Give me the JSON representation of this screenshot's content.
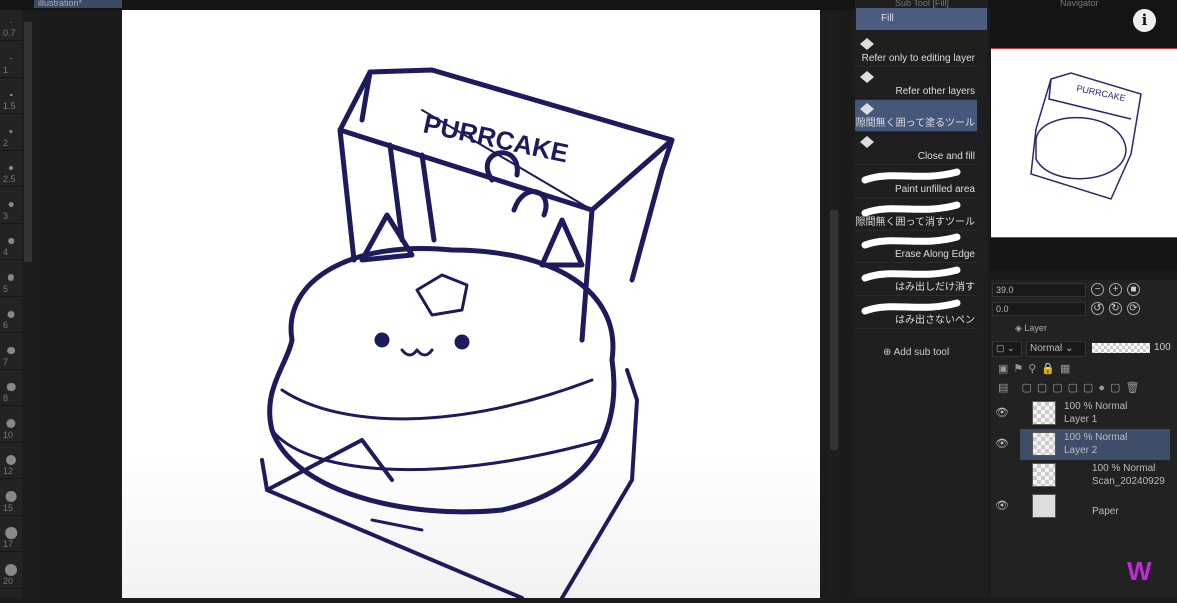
{
  "document_tab": "illustration*",
  "brush_sizes": [
    "0.7",
    "1",
    "1.5",
    "2",
    "2.5",
    "3",
    "4",
    "5",
    "6",
    "7",
    "8",
    "10",
    "12",
    "15",
    "17",
    "20"
  ],
  "subtool_panel": {
    "title": "Sub Tool [Fill]",
    "group": "Fill",
    "items": [
      {
        "label": "Refer only to editing layer",
        "selected": false
      },
      {
        "label": "Refer other layers",
        "selected": false
      },
      {
        "label": "隙間無く囲って塗るツール",
        "selected": true
      },
      {
        "label": "Close and fill",
        "selected": false
      },
      {
        "label": "Paint unfilled area",
        "selected": false
      },
      {
        "label": "隙間無く囲って消すツール",
        "selected": false
      },
      {
        "label": "Erase Along Edge",
        "selected": false
      },
      {
        "label": "はみ出しだけ消す",
        "selected": false
      },
      {
        "label": "はみ出さないペン",
        "selected": false
      }
    ],
    "add_label": "Add sub tool"
  },
  "navigator": {
    "title": "Navigator",
    "zoom": "39.0",
    "rotation": "0.0",
    "preview_text": "PURRCAKE"
  },
  "layer_panel": {
    "tab": "Layer",
    "blend_mode": "Normal",
    "opacity": "100",
    "layers": [
      {
        "mode": "100 % Normal",
        "name": "Layer 1",
        "visible": true,
        "selected": false
      },
      {
        "mode": "100 % Normal",
        "name": "Layer 2",
        "visible": true,
        "selected": true
      },
      {
        "mode": "100 % Normal",
        "name": "Scan_20240929",
        "visible": false,
        "selected": false
      },
      {
        "mode": "",
        "name": "Paper",
        "visible": true,
        "selected": false
      }
    ]
  },
  "canvas": {
    "drawing_text": "PURRCAKE",
    "ink_color": "#1e1a5e"
  },
  "accent": "#46587a"
}
